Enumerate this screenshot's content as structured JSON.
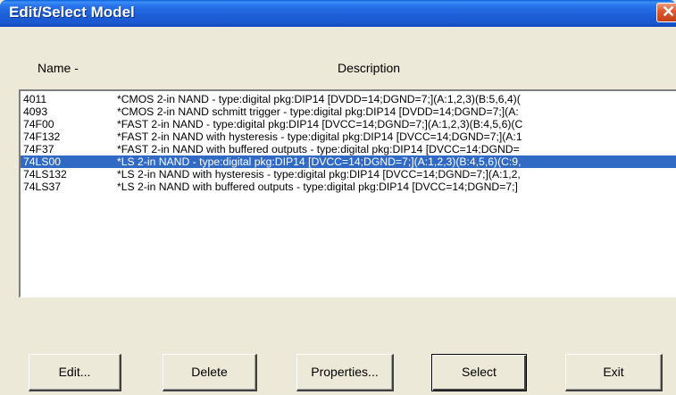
{
  "window": {
    "title": "Edit/Select Model",
    "close_glyph": "✕"
  },
  "columns": {
    "name": "Name -",
    "description": "Description"
  },
  "models": [
    {
      "name": "4011",
      "description": "*CMOS 2-in NAND - type:digital pkg:DIP14 [DVDD=14;DGND=7;](A:1,2,3)(B:5,6,4)(",
      "selected": false
    },
    {
      "name": "4093",
      "description": "*CMOS 2-in NAND schmitt trigger - type:digital pkg:DIP14 [DVDD=14;DGND=7;](A:",
      "selected": false
    },
    {
      "name": "74F00",
      "description": "*FAST 2-in NAND - type:digital pkg:DIP14 [DVCC=14;DGND=7;](A:1,2,3)(B:4,5,6)(C",
      "selected": false
    },
    {
      "name": "74F132",
      "description": "*FAST 2-in NAND with hysteresis - type:digital pkg:DIP14 [DVCC=14;DGND=7;](A:1",
      "selected": false
    },
    {
      "name": "74F37",
      "description": "*FAST 2-in NAND with buffered outputs - type:digital pkg:DIP14 [DVCC=14;DGND=",
      "selected": false
    },
    {
      "name": "74LS00",
      "description": "*LS 2-in NAND - type:digital pkg:DIP14 [DVCC=14;DGND=7;](A:1,2,3)(B:4,5,6)(C:9,",
      "selected": true
    },
    {
      "name": "74LS132",
      "description": "*LS 2-in NAND with hysteresis - type:digital pkg:DIP14 [DVCC=14;DGND=7;](A:1,2,",
      "selected": false
    },
    {
      "name": "74LS37",
      "description": "*LS 2-in NAND with buffered outputs - type:digital pkg:DIP14 [DVCC=14;DGND=7;]",
      "selected": false
    }
  ],
  "buttons": {
    "edit": "Edit...",
    "delete": "Delete",
    "properties": "Properties...",
    "select": "Select",
    "exit": "Exit"
  },
  "colors": {
    "selection": "#316ac5",
    "face": "#ece9d8"
  }
}
